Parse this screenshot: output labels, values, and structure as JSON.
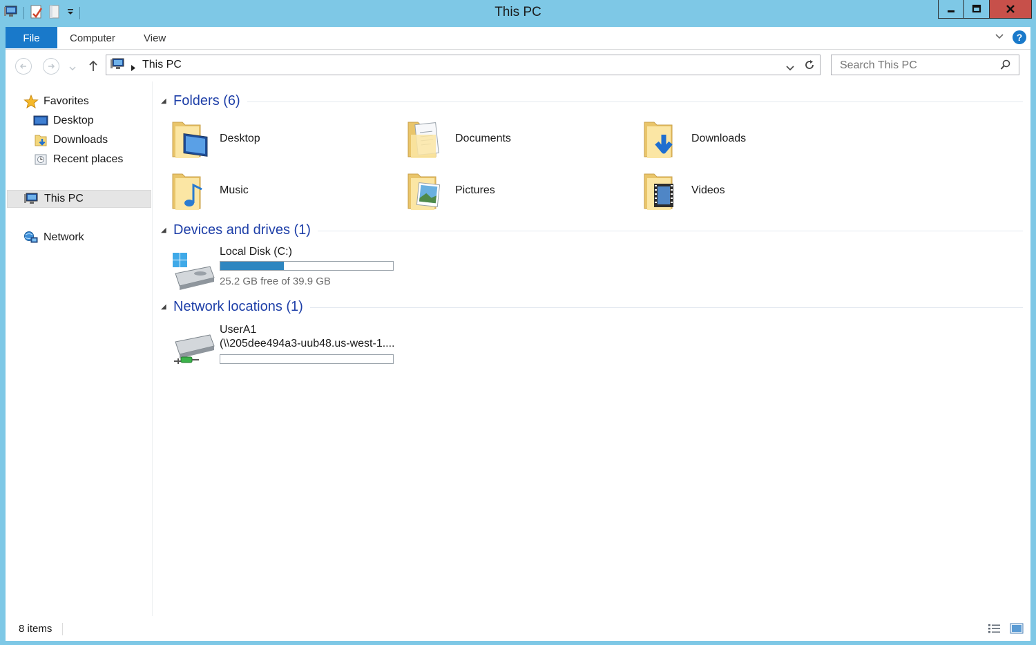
{
  "window": {
    "title": "This PC"
  },
  "ribbon": {
    "tabs": [
      {
        "label": "File"
      },
      {
        "label": "Computer"
      },
      {
        "label": "View"
      }
    ]
  },
  "address": {
    "crumb": "This PC",
    "search_placeholder": "Search This PC"
  },
  "nav_pane": {
    "favorites": "Favorites",
    "items": [
      {
        "label": "Desktop"
      },
      {
        "label": "Downloads"
      },
      {
        "label": "Recent places"
      }
    ],
    "this_pc": "This PC",
    "network": "Network"
  },
  "groups": {
    "folders": {
      "title": "Folders (6)"
    },
    "devices": {
      "title": "Devices and drives (1)"
    },
    "netloc": {
      "title": "Network locations (1)"
    }
  },
  "folders": [
    {
      "label": "Desktop"
    },
    {
      "label": "Documents"
    },
    {
      "label": "Downloads"
    },
    {
      "label": "Music"
    },
    {
      "label": "Pictures"
    },
    {
      "label": "Videos"
    }
  ],
  "drive": {
    "name": "Local Disk (C:)",
    "free_text": "25.2 GB free of 39.9 GB",
    "used_fraction": 0.368
  },
  "network_location": {
    "name": "UserA1",
    "path": "(\\\\205dee494a3-uub48.us-west-1....",
    "used_fraction": 0
  },
  "status": {
    "count": "8 items"
  },
  "colors": {
    "accent": "#1979ca",
    "titlebar": "#7ec8e6",
    "group_title": "#1e3fa8",
    "drive_bar": "#2e86c0",
    "close": "#c7504a"
  }
}
